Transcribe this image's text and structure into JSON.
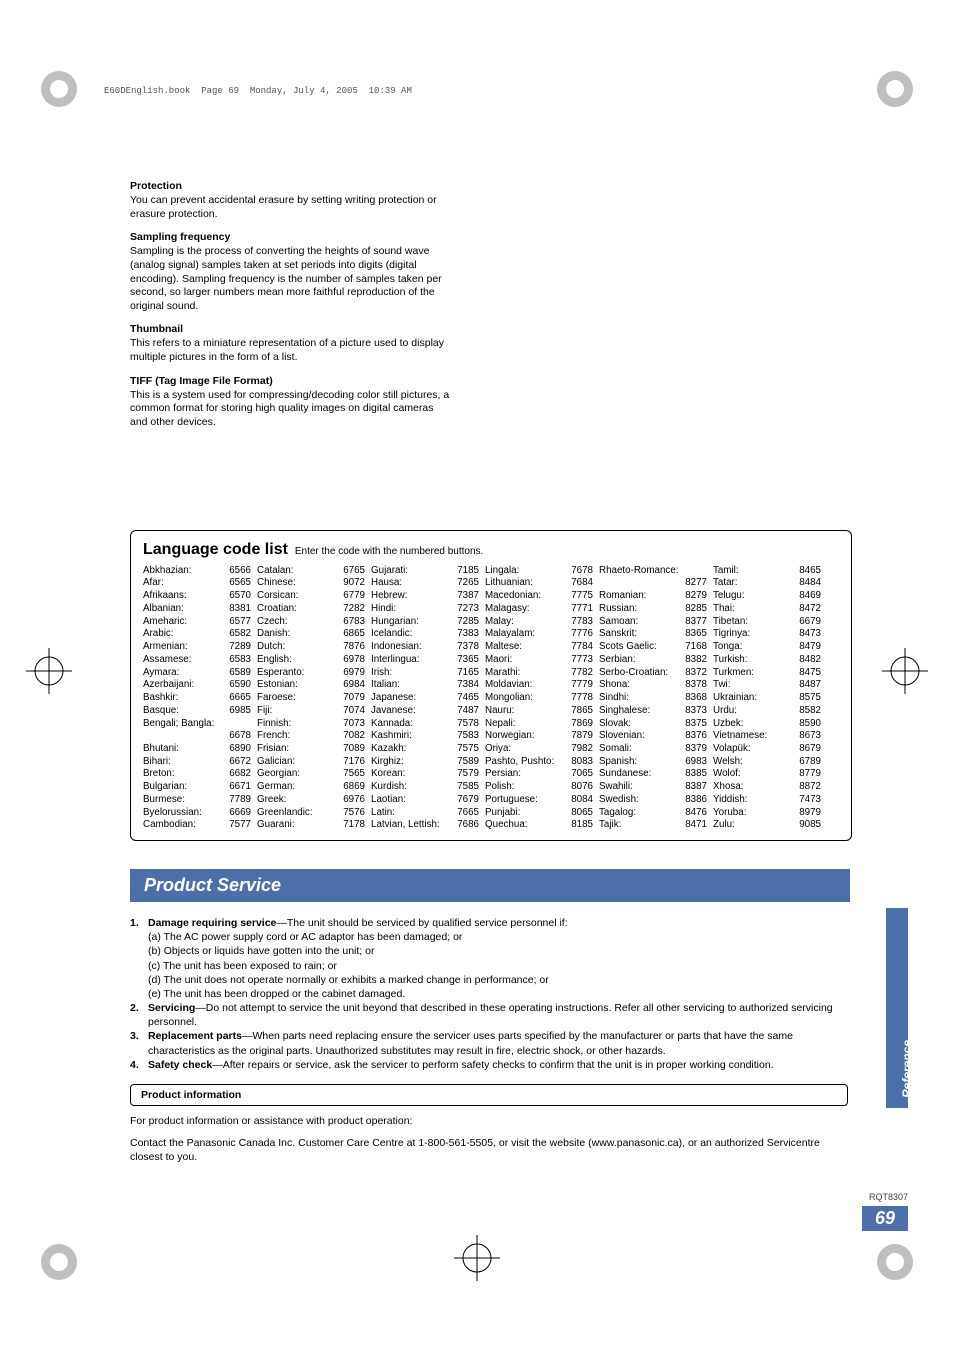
{
  "book_header": "E60DEnglish.book  Page 69  Monday, July 4, 2005  10:39 AM",
  "definitions": [
    {
      "term": "Protection",
      "body": "You can prevent accidental erasure by setting writing protection or erasure protection."
    },
    {
      "term": "Sampling frequency",
      "body": "Sampling is the process of converting the heights of sound wave (analog signal) samples taken at set periods into digits (digital encoding). Sampling frequency is the number of samples taken per second, so larger numbers mean more faithful reproduction of the original sound."
    },
    {
      "term": "Thumbnail",
      "body": "This refers to a miniature representation of a picture used to display multiple pictures in the form of a list."
    },
    {
      "term": "TIFF (Tag Image File Format)",
      "body": "This is a system used for compressing/decoding color still pictures, a common format for storing high quality images on digital cameras and other devices."
    }
  ],
  "lang_section": {
    "title": "Language code list",
    "subtitle": "Enter the code with the numbered buttons.",
    "columns": [
      [
        {
          "n": "Abkhazian:",
          "c": "6566"
        },
        {
          "n": "Afar:",
          "c": "6565"
        },
        {
          "n": "Afrikaans:",
          "c": "6570"
        },
        {
          "n": "Albanian:",
          "c": "8381"
        },
        {
          "n": "Ameharic:",
          "c": "6577"
        },
        {
          "n": "Arabic:",
          "c": "6582"
        },
        {
          "n": "Armenian:",
          "c": "7289"
        },
        {
          "n": "Assamese:",
          "c": "6583"
        },
        {
          "n": "Aymara:",
          "c": "6589"
        },
        {
          "n": "Azerbaijani:",
          "c": "6590"
        },
        {
          "n": "Bashkir:",
          "c": "6665"
        },
        {
          "n": "Basque:",
          "c": "6985"
        },
        {
          "n": "Bengali; Bangla:",
          "c": ""
        },
        {
          "n": "",
          "c": "6678"
        },
        {
          "n": "Bhutani:",
          "c": "6890"
        },
        {
          "n": "Bihari:",
          "c": "6672"
        },
        {
          "n": "Breton:",
          "c": "6682"
        },
        {
          "n": "Bulgarian:",
          "c": "6671"
        },
        {
          "n": "Burmese:",
          "c": "7789"
        },
        {
          "n": "Byelorussian:",
          "c": "6669"
        },
        {
          "n": "Cambodian:",
          "c": "7577"
        }
      ],
      [
        {
          "n": "Catalan:",
          "c": "6765"
        },
        {
          "n": "Chinese:",
          "c": "9072"
        },
        {
          "n": "Corsican:",
          "c": "6779"
        },
        {
          "n": "Croatian:",
          "c": "7282"
        },
        {
          "n": "Czech:",
          "c": "6783"
        },
        {
          "n": "Danish:",
          "c": "6865"
        },
        {
          "n": "Dutch:",
          "c": "7876"
        },
        {
          "n": "English:",
          "c": "6978"
        },
        {
          "n": "Esperanto:",
          "c": "6979"
        },
        {
          "n": "Estonian:",
          "c": "6984"
        },
        {
          "n": "Faroese:",
          "c": "7079"
        },
        {
          "n": "Fiji:",
          "c": "7074"
        },
        {
          "n": "Finnish:",
          "c": "7073"
        },
        {
          "n": "French:",
          "c": "7082"
        },
        {
          "n": "Frisian:",
          "c": "7089"
        },
        {
          "n": "Galician:",
          "c": "7176"
        },
        {
          "n": "Georgian:",
          "c": "7565"
        },
        {
          "n": "German:",
          "c": "6869"
        },
        {
          "n": "Greek:",
          "c": "6976"
        },
        {
          "n": "Greenlandic:",
          "c": "7576"
        },
        {
          "n": "Guarani:",
          "c": "7178"
        }
      ],
      [
        {
          "n": "Gujarati:",
          "c": "7185"
        },
        {
          "n": "Hausa:",
          "c": "7265"
        },
        {
          "n": "Hebrew:",
          "c": "7387"
        },
        {
          "n": "Hindi:",
          "c": "7273"
        },
        {
          "n": "Hungarian:",
          "c": "7285"
        },
        {
          "n": "Icelandic:",
          "c": "7383"
        },
        {
          "n": "Indonesian:",
          "c": "7378"
        },
        {
          "n": "Interlingua:",
          "c": "7365"
        },
        {
          "n": "Irish:",
          "c": "7165"
        },
        {
          "n": "Italian:",
          "c": "7384"
        },
        {
          "n": "Japanese:",
          "c": "7465"
        },
        {
          "n": "Javanese:",
          "c": "7487"
        },
        {
          "n": "Kannada:",
          "c": "7578"
        },
        {
          "n": "Kashmiri:",
          "c": "7583"
        },
        {
          "n": "Kazakh:",
          "c": "7575"
        },
        {
          "n": "Kirghiz:",
          "c": "7589"
        },
        {
          "n": "Korean:",
          "c": "7579"
        },
        {
          "n": "Kurdish:",
          "c": "7585"
        },
        {
          "n": "Laotian:",
          "c": "7679"
        },
        {
          "n": "Latin:",
          "c": "7665"
        },
        {
          "n": "Latvian, Lettish:",
          "c": "7686"
        }
      ],
      [
        {
          "n": "Lingala:",
          "c": "7678"
        },
        {
          "n": "Lithuanian:",
          "c": "7684"
        },
        {
          "n": "Macedonian:",
          "c": "7775"
        },
        {
          "n": "Malagasy:",
          "c": "7771"
        },
        {
          "n": "Malay:",
          "c": "7783"
        },
        {
          "n": "Malayalam:",
          "c": "7776"
        },
        {
          "n": "Maltese:",
          "c": "7784"
        },
        {
          "n": "Maori:",
          "c": "7773"
        },
        {
          "n": "Marathi:",
          "c": "7782"
        },
        {
          "n": "Moldavian:",
          "c": "7779"
        },
        {
          "n": "Mongolian:",
          "c": "7778"
        },
        {
          "n": "Nauru:",
          "c": "7865"
        },
        {
          "n": "Nepali:",
          "c": "7869"
        },
        {
          "n": "Norwegian:",
          "c": "7879"
        },
        {
          "n": "Oriya:",
          "c": "7982"
        },
        {
          "n": "Pashto, Pushto:",
          "c": "8083"
        },
        {
          "n": "Persian:",
          "c": "7065"
        },
        {
          "n": "Polish:",
          "c": "8076"
        },
        {
          "n": "Portuguese:",
          "c": "8084"
        },
        {
          "n": "Punjabi:",
          "c": "8065"
        },
        {
          "n": "Quechua:",
          "c": "8185"
        }
      ],
      [
        {
          "n": "Rhaeto-Romance:",
          "c": ""
        },
        {
          "n": "",
          "c": "8277"
        },
        {
          "n": "Romanian:",
          "c": "8279"
        },
        {
          "n": "Russian:",
          "c": "8285"
        },
        {
          "n": "Samoan:",
          "c": "8377"
        },
        {
          "n": "Sanskrit:",
          "c": "8365"
        },
        {
          "n": "Scots Gaelic:",
          "c": "7168"
        },
        {
          "n": "Serbian:",
          "c": "8382"
        },
        {
          "n": "Serbo-Croatian:",
          "c": "8372"
        },
        {
          "n": "Shona:",
          "c": "8378"
        },
        {
          "n": "Sindhi:",
          "c": "8368"
        },
        {
          "n": "Singhalese:",
          "c": "8373"
        },
        {
          "n": "Slovak:",
          "c": "8375"
        },
        {
          "n": "Slovenian:",
          "c": "8376"
        },
        {
          "n": "Somali:",
          "c": "8379"
        },
        {
          "n": "Spanish:",
          "c": "6983"
        },
        {
          "n": "Sundanese:",
          "c": "8385"
        },
        {
          "n": "Swahili:",
          "c": "8387"
        },
        {
          "n": "Swedish:",
          "c": "8386"
        },
        {
          "n": "Tagalog:",
          "c": "8476"
        },
        {
          "n": "Tajik:",
          "c": "8471"
        }
      ],
      [
        {
          "n": "Tamil:",
          "c": "8465"
        },
        {
          "n": "Tatar:",
          "c": "8484"
        },
        {
          "n": "Telugu:",
          "c": "8469"
        },
        {
          "n": "Thai:",
          "c": "8472"
        },
        {
          "n": "Tibetan:",
          "c": "6679"
        },
        {
          "n": "Tigrinya:",
          "c": "8473"
        },
        {
          "n": "Tonga:",
          "c": "8479"
        },
        {
          "n": "Turkish:",
          "c": "8482"
        },
        {
          "n": "Turkmen:",
          "c": "8475"
        },
        {
          "n": "Twi:",
          "c": "8487"
        },
        {
          "n": "Ukrainian:",
          "c": "8575"
        },
        {
          "n": "Urdu:",
          "c": "8582"
        },
        {
          "n": "Uzbek:",
          "c": "8590"
        },
        {
          "n": "Vietnamese:",
          "c": "8673"
        },
        {
          "n": "Volapük:",
          "c": "8679"
        },
        {
          "n": "Welsh:",
          "c": "6789"
        },
        {
          "n": "Wolof:",
          "c": "8779"
        },
        {
          "n": "Xhosa:",
          "c": "8872"
        },
        {
          "n": "Yiddish:",
          "c": "7473"
        },
        {
          "n": "Yoruba:",
          "c": "8979"
        },
        {
          "n": "Zulu:",
          "c": "9085"
        }
      ]
    ]
  },
  "service": {
    "title": "Product Service",
    "items": [
      {
        "num": "1.",
        "lead": "Damage requiring service",
        "tail": "—The unit should be serviced by qualified service personnel if:",
        "subs": [
          "(a) The AC power supply cord or AC adaptor has been damaged; or",
          "(b) Objects or liquids have gotten into the unit; or",
          "(c) The unit has been exposed to rain; or",
          "(d) The unit does not operate normally or exhibits a marked change in performance; or",
          "(e) The unit has been dropped or the cabinet damaged."
        ]
      },
      {
        "num": "2.",
        "lead": "Servicing",
        "tail": "—Do not attempt to service the unit beyond that described in these operating instructions. Refer all other servicing to authorized servicing personnel."
      },
      {
        "num": "3.",
        "lead": "Replacement parts",
        "tail": "—When parts need replacing ensure the servicer uses parts specified by the manufacturer or parts that have the same characteristics as the original parts. Unauthorized substitutes may result in fire, electric shock, or other hazards."
      },
      {
        "num": "4.",
        "lead": "Safety check",
        "tail": "—After repairs or service, ask the servicer to perform safety checks to confirm that the unit is in proper working condition."
      }
    ]
  },
  "product_info": {
    "header": "Product information",
    "l1": "For product information or assistance with product operation:",
    "l2": "Contact the Panasonic Canada Inc. Customer Care Centre at 1-800-561-5505, or visit the website (www.panasonic.ca), or an authorized Servicentre closest to you."
  },
  "side_tab": "Reference",
  "footer": {
    "doc_id": "RQT8307",
    "page": "69"
  }
}
